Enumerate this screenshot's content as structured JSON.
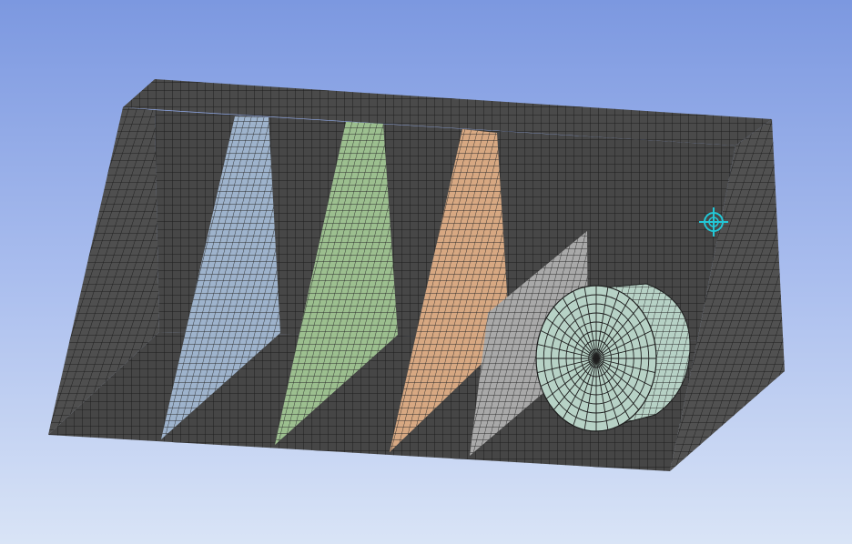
{
  "viewport": {
    "background_top": "#7c98e0",
    "background_bottom": "#d9e4f6"
  },
  "model": {
    "body_color": "#4a4a4a",
    "mesh_line_color": "#1e1e1e",
    "panels": [
      {
        "name": "blue-panel",
        "color": "#9eb3cc"
      },
      {
        "name": "green-panel",
        "color": "#9cbf8f"
      },
      {
        "name": "orange-panel",
        "color": "#d7a882"
      },
      {
        "name": "gray-panel",
        "color": "#a9a9a9"
      }
    ],
    "cylinder_color": "#b7d2c6"
  },
  "triad": {
    "icon": "crosshair-icon",
    "color": "#22c7d6"
  }
}
